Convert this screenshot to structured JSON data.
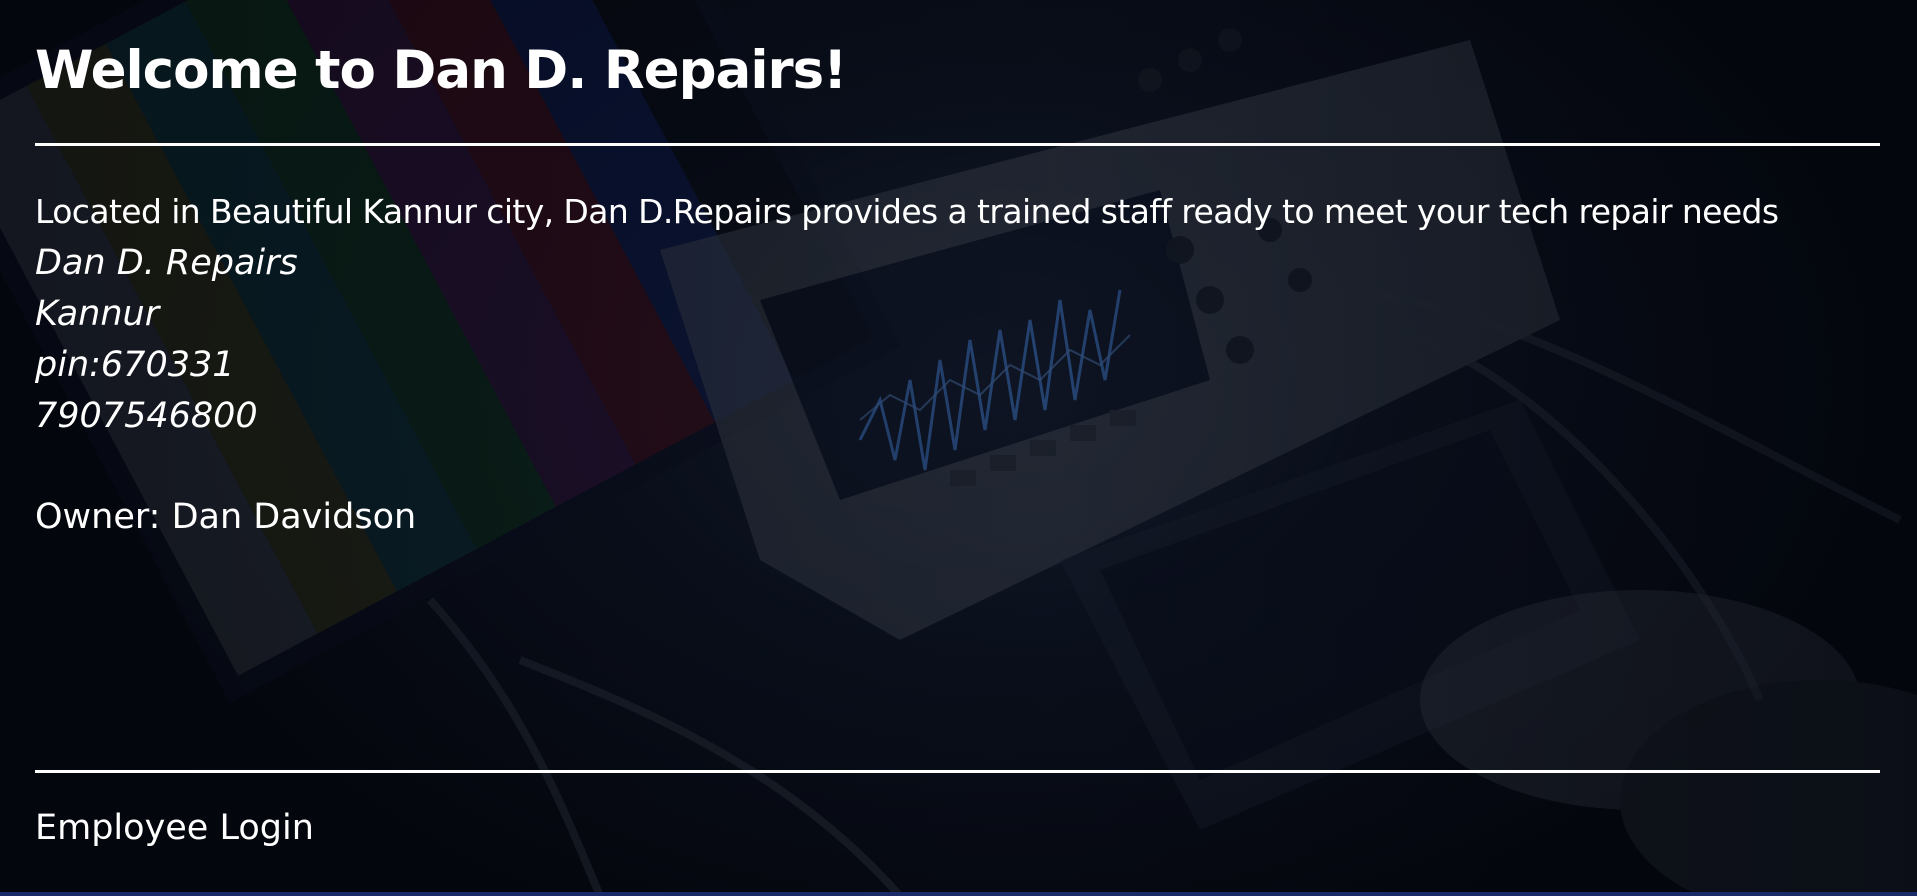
{
  "header": {
    "title": "Welcome to Dan D. Repairs!"
  },
  "main": {
    "intro": "Located in Beautiful Kannur city, Dan D.Repairs provides a trained staff ready to meet your tech repair needs",
    "address": {
      "business_name": "Dan D. Repairs",
      "city": "Kannur",
      "pin": "pin:670331",
      "phone": "7907546800"
    },
    "owner": "Owner: Dan Davidson"
  },
  "footer": {
    "login_link": "Employee Login"
  },
  "colors": {
    "text": "#ffffff",
    "background": "#05070d",
    "bottom_strip": "#1b2a68"
  }
}
